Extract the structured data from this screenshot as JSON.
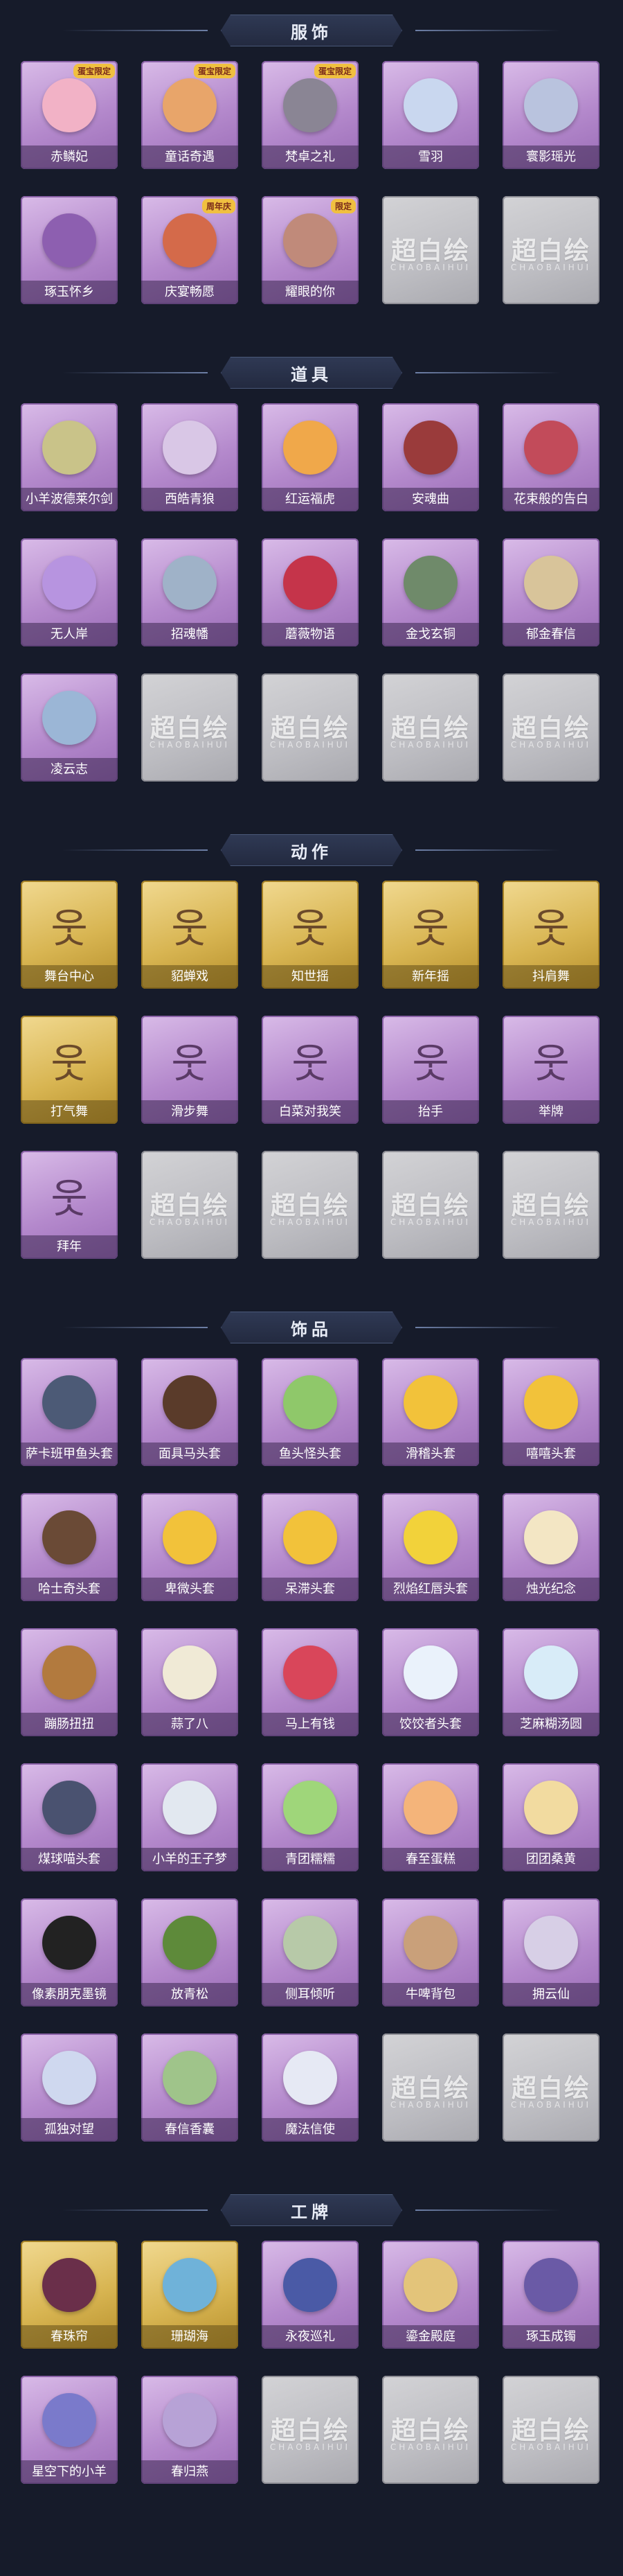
{
  "sections": [
    {
      "title": "服饰",
      "items": [
        {
          "label": "赤鳞妃",
          "badge": "蛋宝限定",
          "style": "purple",
          "color": "#f2b2c6"
        },
        {
          "label": "童话奇遇",
          "badge": "蛋宝限定",
          "style": "purple",
          "color": "#e8a56a"
        },
        {
          "label": "梵卓之礼",
          "badge": "蛋宝限定",
          "style": "purple",
          "color": "#8a8594"
        },
        {
          "label": "雪羽",
          "badge": "",
          "style": "purple",
          "color": "#c9d7ef"
        },
        {
          "label": "寰影瑶光",
          "badge": "",
          "style": "purple",
          "color": "#b9c3de"
        },
        {
          "label": "琢玉怀乡",
          "badge": "",
          "style": "purple",
          "color": "#8d5fb0"
        },
        {
          "label": "庆宴畅愿",
          "badge": "周年庆",
          "style": "purple",
          "color": "#d46a4a"
        },
        {
          "label": "耀眼的你",
          "badge": "限定",
          "style": "purple",
          "color": "#c08a7a"
        },
        {
          "label": "",
          "style": "empty"
        },
        {
          "label": "",
          "style": "empty"
        }
      ]
    },
    {
      "title": "道具",
      "items": [
        {
          "label": "小羊波德莱尔剑",
          "badge": "",
          "style": "purple",
          "color": "#c9c389"
        },
        {
          "label": "西皓青狼",
          "badge": "",
          "style": "purple",
          "color": "#d9c7e6"
        },
        {
          "label": "红运福虎",
          "badge": "",
          "style": "purple",
          "color": "#f0a84a"
        },
        {
          "label": "安魂曲",
          "badge": "",
          "style": "purple",
          "color": "#9a3b3b"
        },
        {
          "label": "花束般的告白",
          "badge": "",
          "style": "purple",
          "color": "#c24b5a"
        },
        {
          "label": "无人岸",
          "badge": "",
          "style": "purple",
          "color": "#b794e0"
        },
        {
          "label": "招魂幡",
          "badge": "",
          "style": "purple",
          "color": "#9fb2c8"
        },
        {
          "label": "蘑薇物语",
          "badge": "",
          "style": "purple",
          "color": "#c5344a"
        },
        {
          "label": "金戈玄铜",
          "badge": "",
          "style": "purple",
          "color": "#6f8a6a"
        },
        {
          "label": "郁金春信",
          "badge": "",
          "style": "purple",
          "color": "#d8c49a"
        },
        {
          "label": "凌云志",
          "badge": "",
          "style": "purple",
          "color": "#9bb6d6"
        },
        {
          "label": "",
          "style": "empty"
        },
        {
          "label": "",
          "style": "empty"
        },
        {
          "label": "",
          "style": "empty"
        },
        {
          "label": "",
          "style": "empty"
        }
      ]
    },
    {
      "title": "动作",
      "items": [
        {
          "label": "舞台中心",
          "badge": "",
          "style": "gold",
          "icon": "pose"
        },
        {
          "label": "貂蝉戏",
          "badge": "",
          "style": "gold",
          "icon": "pose"
        },
        {
          "label": "知世摇",
          "badge": "",
          "style": "gold",
          "icon": "pose"
        },
        {
          "label": "新年摇",
          "badge": "",
          "style": "gold",
          "icon": "pose"
        },
        {
          "label": "抖肩舞",
          "badge": "",
          "style": "gold",
          "icon": "pose"
        },
        {
          "label": "打气舞",
          "badge": "",
          "style": "gold",
          "icon": "pose"
        },
        {
          "label": "滑步舞",
          "badge": "",
          "style": "purple",
          "icon": "pose"
        },
        {
          "label": "白菜对我笑",
          "badge": "",
          "style": "purple",
          "icon": "pose"
        },
        {
          "label": "抬手",
          "badge": "",
          "style": "purple",
          "icon": "pose"
        },
        {
          "label": "举牌",
          "badge": "",
          "style": "purple",
          "icon": "pose"
        },
        {
          "label": "拜年",
          "badge": "",
          "style": "purple",
          "icon": "pose"
        },
        {
          "label": "",
          "style": "empty"
        },
        {
          "label": "",
          "style": "empty"
        },
        {
          "label": "",
          "style": "empty"
        },
        {
          "label": "",
          "style": "empty"
        }
      ]
    },
    {
      "title": "饰品",
      "items": [
        {
          "label": "萨卡班甲鱼头套",
          "style": "purple",
          "color": "#4c5a76"
        },
        {
          "label": "面具马头套",
          "style": "purple",
          "color": "#5a3b2a"
        },
        {
          "label": "鱼头怪头套",
          "style": "purple",
          "color": "#8fc86a"
        },
        {
          "label": "滑稽头套",
          "style": "purple",
          "color": "#f2c23a"
        },
        {
          "label": "嘻嘻头套",
          "style": "purple",
          "color": "#f2c23a"
        },
        {
          "label": "哈士奇头套",
          "style": "purple",
          "color": "#6a4a36"
        },
        {
          "label": "卑微头套",
          "style": "purple",
          "color": "#f2c23a"
        },
        {
          "label": "呆滞头套",
          "style": "purple",
          "color": "#f2c23a"
        },
        {
          "label": "烈焰红唇头套",
          "style": "purple",
          "color": "#f2d23a"
        },
        {
          "label": "烛光纪念",
          "style": "purple",
          "color": "#f3e6c4"
        },
        {
          "label": "蹦肠扭扭",
          "style": "purple",
          "color": "#b27a3e"
        },
        {
          "label": "蒜了八",
          "style": "purple",
          "color": "#f0ead6"
        },
        {
          "label": "马上有钱",
          "style": "purple",
          "color": "#d9465a"
        },
        {
          "label": "饺饺者头套",
          "style": "purple",
          "color": "#eaf2fb"
        },
        {
          "label": "芝麻糊汤圆",
          "style": "purple",
          "color": "#d8ecf8"
        },
        {
          "label": "煤球喵头套",
          "style": "purple",
          "color": "#4a5270"
        },
        {
          "label": "小羊的王子梦",
          "style": "purple",
          "color": "#e2e8f0"
        },
        {
          "label": "青团糯糯",
          "style": "purple",
          "color": "#9fd67a"
        },
        {
          "label": "春至蛋糕",
          "style": "purple",
          "color": "#f4b47a"
        },
        {
          "label": "团团桑黄",
          "style": "purple",
          "color": "#f2dba0"
        },
        {
          "label": "像素朋克墨镜",
          "style": "purple",
          "color": "#222222"
        },
        {
          "label": "放青松",
          "style": "purple",
          "color": "#5e8a3a"
        },
        {
          "label": "侧耳倾听",
          "style": "purple",
          "color": "#b7c9a8"
        },
        {
          "label": "牛啤背包",
          "style": "purple",
          "color": "#c9a07a"
        },
        {
          "label": "拥云仙",
          "style": "purple",
          "color": "#d7cfe6"
        },
        {
          "label": "孤独对望",
          "style": "purple",
          "color": "#cfd8ef"
        },
        {
          "label": "春信香囊",
          "style": "purple",
          "color": "#9fc48a"
        },
        {
          "label": "魔法信使",
          "style": "purple",
          "color": "#e6e9f4"
        },
        {
          "label": "",
          "style": "empty"
        },
        {
          "label": "",
          "style": "empty"
        }
      ]
    },
    {
      "title": "工牌",
      "items": [
        {
          "label": "春珠帘",
          "style": "gold",
          "color": "#6a2f4a"
        },
        {
          "label": "珊瑚海",
          "style": "gold",
          "color": "#6fb2d9"
        },
        {
          "label": "永夜巡礼",
          "style": "purple",
          "color": "#4a5aa6"
        },
        {
          "label": "鎏金殿庭",
          "style": "purple",
          "color": "#e3c47a"
        },
        {
          "label": "琢玉成镯",
          "style": "purple",
          "color": "#6a5aa6"
        },
        {
          "label": "星空下的小羊",
          "style": "purple",
          "color": "#7a7acb"
        },
        {
          "label": "春归燕",
          "style": "purple",
          "color": "#b7a2d6"
        },
        {
          "label": "",
          "style": "empty"
        },
        {
          "label": "",
          "style": "empty"
        },
        {
          "label": "",
          "style": "empty"
        }
      ]
    }
  ],
  "empty_placeholder": {
    "mark": "超白绘",
    "sub": "CHAOBAIHUI"
  }
}
